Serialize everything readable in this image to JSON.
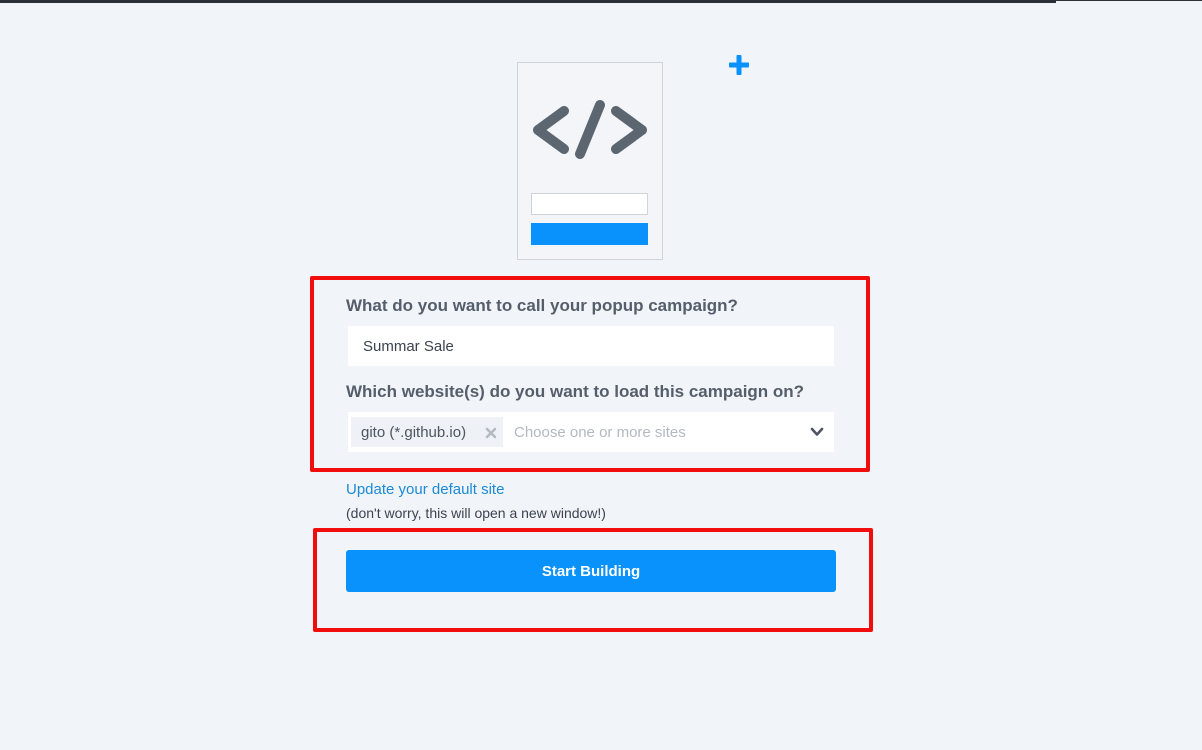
{
  "form": {
    "campaign_name_label": "What do you want to call your popup campaign?",
    "campaign_name_value": "Summar Sale",
    "websites_label": "Which website(s) do you want to load this campaign on?",
    "selected_sites": [
      {
        "label": "gito (*.github.io)"
      }
    ],
    "sites_placeholder": "Choose one or more sites",
    "update_site_link": "Update your default site",
    "update_site_note": "(don't worry, this will open a new window!)",
    "start_button_label": "Start Building"
  },
  "icons": {
    "illustration": "code-embed-icon",
    "add": "plus-icon",
    "tag_remove": "close-icon",
    "dropdown": "chevron-down-icon"
  },
  "colors": {
    "accent": "#0992fb",
    "background": "#f1f4f8",
    "highlight": "#f20d0d",
    "link": "#1b8ad8"
  }
}
